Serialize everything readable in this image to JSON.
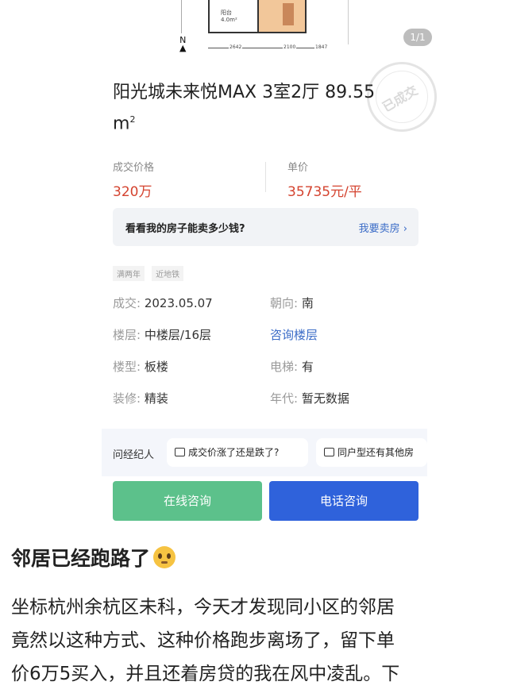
{
  "gallery": {
    "counter": "1/1"
  },
  "floorplan": {
    "room_label": "阳台",
    "room_area": "4.0m²",
    "dims": [
      "2642",
      "2100",
      "1847"
    ],
    "north": "N"
  },
  "listing": {
    "title": "阳光城未来悦MAX 3室2厅 89.55",
    "title_unit": "m",
    "title_sup": "2",
    "stamp": "已成交"
  },
  "price": {
    "deal_label": "成交价格",
    "deal_value": "320万",
    "unit_label": "单价",
    "unit_value": "35735元/平"
  },
  "banner": {
    "question": "看看我的房子能卖多少钱?",
    "action": "我要卖房 ›"
  },
  "tags": [
    "满两年",
    "近地铁"
  ],
  "details": {
    "rows": [
      {
        "k1": "成交:",
        "v1": "2023.05.07",
        "k2": "朝向:",
        "v2": "南"
      },
      {
        "k1": "楼层:",
        "v1": "中楼层/16层",
        "k2": "",
        "v2": "咨询楼层"
      },
      {
        "k1": "楼型:",
        "v1": "板楼",
        "k2": "电梯:",
        "v2": "有"
      },
      {
        "k1": "装修:",
        "v1": "精装",
        "k2": "年代:",
        "v2": "暂无数据"
      }
    ]
  },
  "ask": {
    "label": "问经纪人",
    "chips": [
      "成交价涨了还是跌了?",
      "同户型还有其他房"
    ]
  },
  "buttons": {
    "online": "在线咨询",
    "phone": "电话咨询"
  },
  "post": {
    "title": "邻居已经跑路了",
    "emoji": "pleading-face-icon",
    "lines": [
      "坐标杭州余杭区未科，今天才发现同小区的邻居",
      "竟然以这种方式、这种价格跑步离场了，留下单",
      "价6万5买入，并且还着房贷的我在风中凌乱。下"
    ]
  },
  "colors": {
    "price_red": "#d4432f",
    "link_blue": "#3b6cc7",
    "green_button": "#5cc18b",
    "blue_button": "#2f62db"
  }
}
